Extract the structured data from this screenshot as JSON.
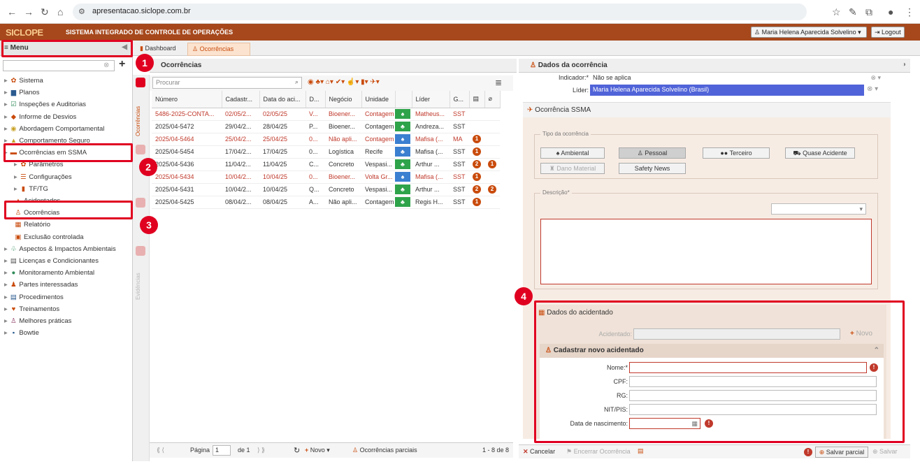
{
  "browser": {
    "url": "apresentacao.siclope.com.br"
  },
  "header": {
    "logo": "SICLOPE",
    "subtitle": "SISTEMA INTEGRADO DE CONTROLE DE OPERAÇÕES",
    "user": "Maria Helena Aparecida Solvelino",
    "logout": "Logout"
  },
  "menu": {
    "title": "Menu"
  },
  "tabs": [
    {
      "label": "Dashboard"
    },
    {
      "label": "Ocorrências"
    }
  ],
  "sidebar": {
    "items": [
      {
        "label": "Sistema"
      },
      {
        "label": "Planos"
      },
      {
        "label": "Inspeções e Auditorias"
      },
      {
        "label": "Informe de Desvios"
      },
      {
        "label": "Abordagem Comportamental"
      },
      {
        "label": "Comportamento Seguro"
      },
      {
        "label": "Ocorrências em SSMA"
      },
      {
        "label": "Parâmetros"
      },
      {
        "label": "Configurações"
      },
      {
        "label": "TF/TG"
      },
      {
        "label": "Acidentados"
      },
      {
        "label": "Ocorrências"
      },
      {
        "label": "Relatório"
      },
      {
        "label": "Exclusão controlada"
      },
      {
        "label": "Aspectos & Impactos Ambientais"
      },
      {
        "label": "Licenças e Condicionantes"
      },
      {
        "label": "Monitoramento Ambiental"
      },
      {
        "label": "Partes interessadas"
      },
      {
        "label": "Procedimentos"
      },
      {
        "label": "Treinamentos"
      },
      {
        "label": "Melhores práticas"
      },
      {
        "label": "Bowtie"
      }
    ]
  },
  "vtabs": {
    "ocorrencias": "Ocorrências",
    "evidencias": "Evidências"
  },
  "badges": [
    "1",
    "2",
    "3",
    "4"
  ],
  "grid": {
    "title": "Ocorrências",
    "search_placeholder": "Procurar",
    "columns": [
      "Número",
      "Cadastr...",
      "Data do aci...",
      "D...",
      "Negócio",
      "Unidade",
      "",
      "Líder",
      "G..."
    ],
    "rows": [
      {
        "numero": "5486-2025-CONTA...",
        "cad": "02/05/2...",
        "data": "02/05/25",
        "d": "V...",
        "negocio": "Bioener...",
        "unidade": "Contagem",
        "icon": "♠",
        "color": "#2ea34a",
        "lider": "Matheus...",
        "g": "SST",
        "n1": "",
        "n2": "",
        "red": true
      },
      {
        "numero": "2025/04-5472",
        "cad": "29/04/2...",
        "data": "28/04/25",
        "d": "P...",
        "negocio": "Bioener...",
        "unidade": "Contagem",
        "icon": "♣",
        "color": "#2ea34a",
        "lider": "Andreza...",
        "g": "SST",
        "n1": "",
        "n2": "",
        "red": false
      },
      {
        "numero": "2025/04-5464",
        "cad": "25/04/2...",
        "data": "25/04/25",
        "d": "0...",
        "negocio": "Não apli...",
        "unidade": "Contagem",
        "icon": "♠",
        "color": "#3a7fd0",
        "lider": "Mafisa (...",
        "g": "MA",
        "n1": "1",
        "n2": "",
        "red": true
      },
      {
        "numero": "2025/04-5454",
        "cad": "17/04/2...",
        "data": "17/04/25",
        "d": "0...",
        "negocio": "Logística",
        "unidade": "Recife",
        "icon": "♣",
        "color": "#3a7fd0",
        "lider": "Mafisa (...",
        "g": "SST",
        "n1": "1",
        "n2": "",
        "red": false
      },
      {
        "numero": "2025/04-5436",
        "cad": "11/04/2...",
        "data": "11/04/25",
        "d": "C...",
        "negocio": "Concreto",
        "unidade": "Vespasi...",
        "icon": "♣",
        "color": "#2ea34a",
        "lider": "Arthur ...",
        "g": "SST",
        "n1": "2",
        "n2": "1",
        "red": false
      },
      {
        "numero": "2025/04-5434",
        "cad": "10/04/2...",
        "data": "10/04/25",
        "d": "0...",
        "negocio": "Bioener...",
        "unidade": "Volta Gr...",
        "icon": "♠",
        "color": "#3a7fd0",
        "lider": "Mafisa (...",
        "g": "SST",
        "n1": "1",
        "n2": "",
        "red": true
      },
      {
        "numero": "2025/04-5431",
        "cad": "10/04/2...",
        "data": "10/04/25",
        "d": "Q...",
        "negocio": "Concreto",
        "unidade": "Vespasi...",
        "icon": "♣",
        "color": "#2ea34a",
        "lider": "Arthur ...",
        "g": "SST",
        "n1": "2",
        "n2": "2",
        "red": false
      },
      {
        "numero": "2025/04-5425",
        "cad": "08/04/2...",
        "data": "08/04/25",
        "d": "A...",
        "negocio": "Não apli...",
        "unidade": "Contagem",
        "icon": "♣",
        "color": "#2ea34a",
        "lider": "Regis H...",
        "g": "SST",
        "n1": "1",
        "n2": "",
        "red": false
      }
    ],
    "pager": {
      "pagina": "Página",
      "page": "1",
      "de": "de 1",
      "novo": "Novo",
      "parciais": "Ocorrências parciais",
      "count": "1 - 8 de 8"
    }
  },
  "details": {
    "title": "Dados da ocorrência",
    "indicador_label": "Indicador:*",
    "indicador_value": "Não se aplica",
    "lider_label": "Líder:",
    "lider_value": "Maria Helena Aparecida Solvelino (Brasil)",
    "ssma_title": "Ocorrência SSMA",
    "tipo_legend": "Tipo da ocorrência",
    "tipos": [
      "Ambiental",
      "Pessoal",
      "Terceiro",
      "Quase Acidente",
      "Dano Material",
      "Safety News"
    ],
    "descricao_legend": "Descrição*",
    "acidentado_title": "Dados do acidentado",
    "acidentado_label": "Acidentado:",
    "novo": "Novo",
    "cadastrar_title": "Cadastrar novo acidentado",
    "fields": [
      "Nome:*",
      "CPF:",
      "RG:",
      "NIT/PIS:",
      "Data de nascimento:"
    ],
    "cancelar": "Cancelar",
    "encerrar": "Encerrar Ocorrência",
    "salvar_parcial": "Salvar parcial",
    "salvar": "Salvar"
  },
  "colors": {
    "header": "#a6481c",
    "highlight": "#e00020",
    "lider_bg": "#5063d8"
  }
}
